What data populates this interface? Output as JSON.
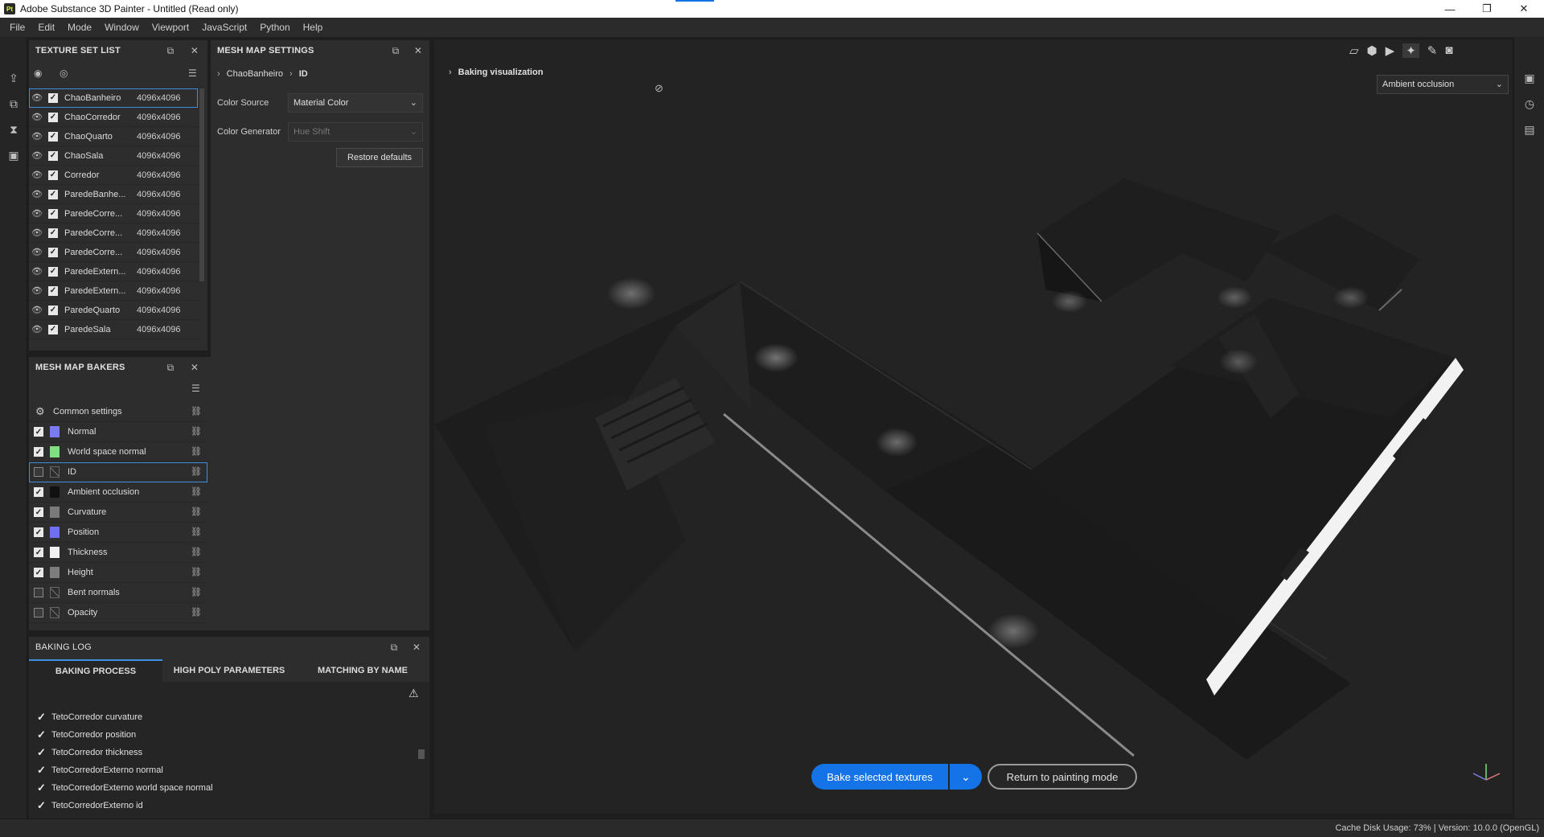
{
  "window": {
    "title": "Adobe Substance 3D Painter - Untitled (Read only)",
    "app_icon": "Pt",
    "controls": {
      "minimize": "—",
      "restore": "❐",
      "close": "✕"
    }
  },
  "menu": [
    "File",
    "Edit",
    "Mode",
    "Window",
    "Viewport",
    "JavaScript",
    "Python",
    "Help"
  ],
  "texture_set_list": {
    "title": "TEXTURE SET LIST",
    "rows": [
      {
        "name": "ChaoBanheiro",
        "res": "4096x4096"
      },
      {
        "name": "ChaoCorredor",
        "res": "4096x4096"
      },
      {
        "name": "ChaoQuarto",
        "res": "4096x4096"
      },
      {
        "name": "ChaoSala",
        "res": "4096x4096"
      },
      {
        "name": "Corredor",
        "res": "4096x4096"
      },
      {
        "name": "ParedeBanhe...",
        "res": "4096x4096"
      },
      {
        "name": "ParedeCorre...",
        "res": "4096x4096"
      },
      {
        "name": "ParedeCorre...",
        "res": "4096x4096"
      },
      {
        "name": "ParedeCorre...",
        "res": "4096x4096"
      },
      {
        "name": "ParedeExtern...",
        "res": "4096x4096"
      },
      {
        "name": "ParedeExtern...",
        "res": "4096x4096"
      },
      {
        "name": "ParedeQuarto",
        "res": "4096x4096"
      },
      {
        "name": "ParedeSala",
        "res": "4096x4096"
      }
    ]
  },
  "mesh_map_settings": {
    "title": "MESH MAP SETTINGS",
    "breadcrumb": [
      "ChaoBanheiro",
      "ID"
    ],
    "color_source_label": "Color Source",
    "color_source_value": "Material Color",
    "color_generator_label": "Color Generator",
    "color_generator_value": "Hue Shift",
    "restore_label": "Restore defaults"
  },
  "mesh_map_bakers": {
    "title": "MESH MAP BAKERS",
    "common": "Common settings",
    "items": [
      {
        "name": "Normal",
        "checked": true,
        "color": "#7b7bf0"
      },
      {
        "name": "World space normal",
        "checked": true,
        "color": "#7fe07f"
      },
      {
        "name": "ID",
        "checked": false,
        "color": ""
      },
      {
        "name": "Ambient occlusion",
        "checked": true,
        "color": "#111111"
      },
      {
        "name": "Curvature",
        "checked": true,
        "color": "#7a7a7a"
      },
      {
        "name": "Position",
        "checked": true,
        "color": "#6f6ff2"
      },
      {
        "name": "Thickness",
        "checked": true,
        "color": "#f2f2f2"
      },
      {
        "name": "Height",
        "checked": true,
        "color": "#7c7c7c"
      },
      {
        "name": "Bent normals",
        "checked": false,
        "color": ""
      },
      {
        "name": "Opacity",
        "checked": false,
        "color": ""
      }
    ]
  },
  "baking_log": {
    "title": "BAKING LOG",
    "tabs": [
      "BAKING PROCESS",
      "HIGH POLY PARAMETERS",
      "MATCHING BY NAME"
    ],
    "lines": [
      "TetoCorredor curvature",
      "TetoCorredor position",
      "TetoCorredor thickness",
      "TetoCorredorExterno normal",
      "TetoCorredorExterno world space normal",
      "TetoCorredorExterno id"
    ]
  },
  "viewport": {
    "baking_visualization": "Baking visualization",
    "map_dropdown": "Ambient occlusion",
    "bake_button": "Bake selected textures",
    "return_button": "Return to painting mode"
  },
  "status": {
    "text": "Cache Disk Usage:    73% | Version: 10.0.0 (OpenGL)"
  },
  "colors": {
    "accent": "#1473e6",
    "selection": "#3d8fe0"
  }
}
